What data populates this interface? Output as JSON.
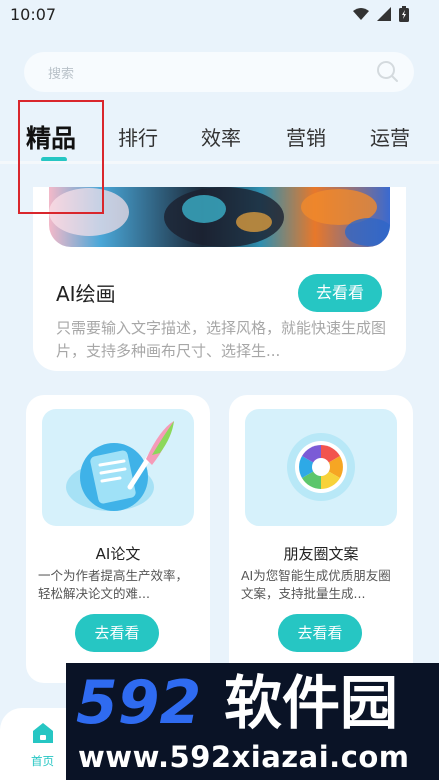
{
  "status_bar": {
    "time": "10:07"
  },
  "search": {
    "placeholder": "搜索"
  },
  "tabs": [
    {
      "label": "精品",
      "active": true
    },
    {
      "label": "排行"
    },
    {
      "label": "效率"
    },
    {
      "label": "营销"
    },
    {
      "label": "运营"
    }
  ],
  "feature": {
    "title": "AI绘画",
    "button": "去看看",
    "description": "只需要输入文字描述，选择风格，就能快速生成图片，支持多种画布尺寸、选择生..."
  },
  "cards": [
    {
      "title": "AI论文",
      "description": "一个为作者提高生产效率，轻松解决论文的难...",
      "button": "去看看",
      "icon": "quill-document-icon"
    },
    {
      "title": "朋友圈文案",
      "description": "AI为您智能生成优质朋友圈文案，支持批量生成...",
      "button": "去看看",
      "icon": "camera-aperture-icon"
    }
  ],
  "bottom_nav": {
    "home_label": "首页"
  },
  "watermark": {
    "logo_text": "592软件园",
    "url": "www.592xiazai.com"
  },
  "colors": {
    "accent": "#26c6c3",
    "background": "#e9f3fb",
    "highlight": "#d9262c"
  }
}
